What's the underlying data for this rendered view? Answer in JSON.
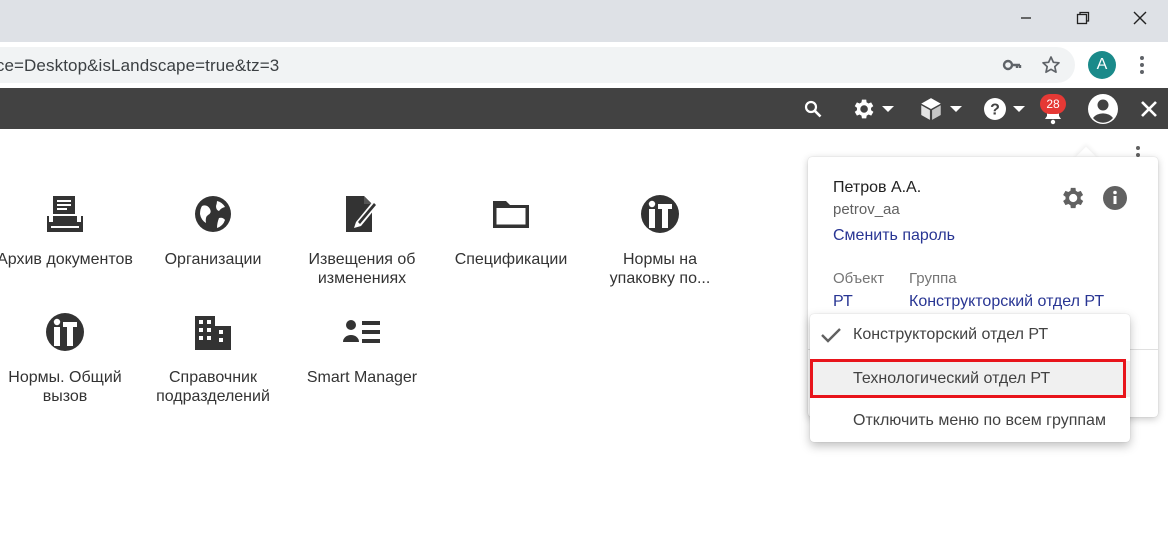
{
  "browser": {
    "url": "ice=Desktop&isLandscape=true&tz=3",
    "profile_initial": "A"
  },
  "appbar": {
    "notification_count": "28"
  },
  "tiles": [
    {
      "label": "Архив документов",
      "icon": "archive-icon"
    },
    {
      "label": "Организации",
      "icon": "globe-icon"
    },
    {
      "label": "Извещения об изменениях",
      "icon": "edit-document-icon"
    },
    {
      "label": "Спецификации",
      "icon": "folder-icon"
    },
    {
      "label": "Нормы на упаковку по...",
      "icon": "it-logo-icon"
    },
    {
      "label": "Нормы. Общий вызов",
      "icon": "it-logo-icon"
    },
    {
      "label": "Справочник подразделений",
      "icon": "building-icon"
    },
    {
      "label": "Smart Manager",
      "icon": "contact-list-icon"
    }
  ],
  "user_card": {
    "name": "Петров А.А.",
    "login": "petrov_aa",
    "change_password": "Сменить пароль",
    "object_header": "Объект",
    "group_header": "Группа",
    "object_value": "РТ",
    "group_value": "Конструкторский отдел РТ"
  },
  "group_menu": {
    "items": [
      {
        "label": "Конструкторский отдел РТ",
        "checked": true
      },
      {
        "label": "Технологический отдел РТ",
        "checked": false,
        "highlighted": true
      },
      {
        "label": "Отключить меню по всем группам",
        "checked": false
      }
    ]
  },
  "colors": {
    "appbar": "#424242",
    "link": "#283593",
    "badge": "#e53935",
    "highlight_border": "#e8141b"
  }
}
